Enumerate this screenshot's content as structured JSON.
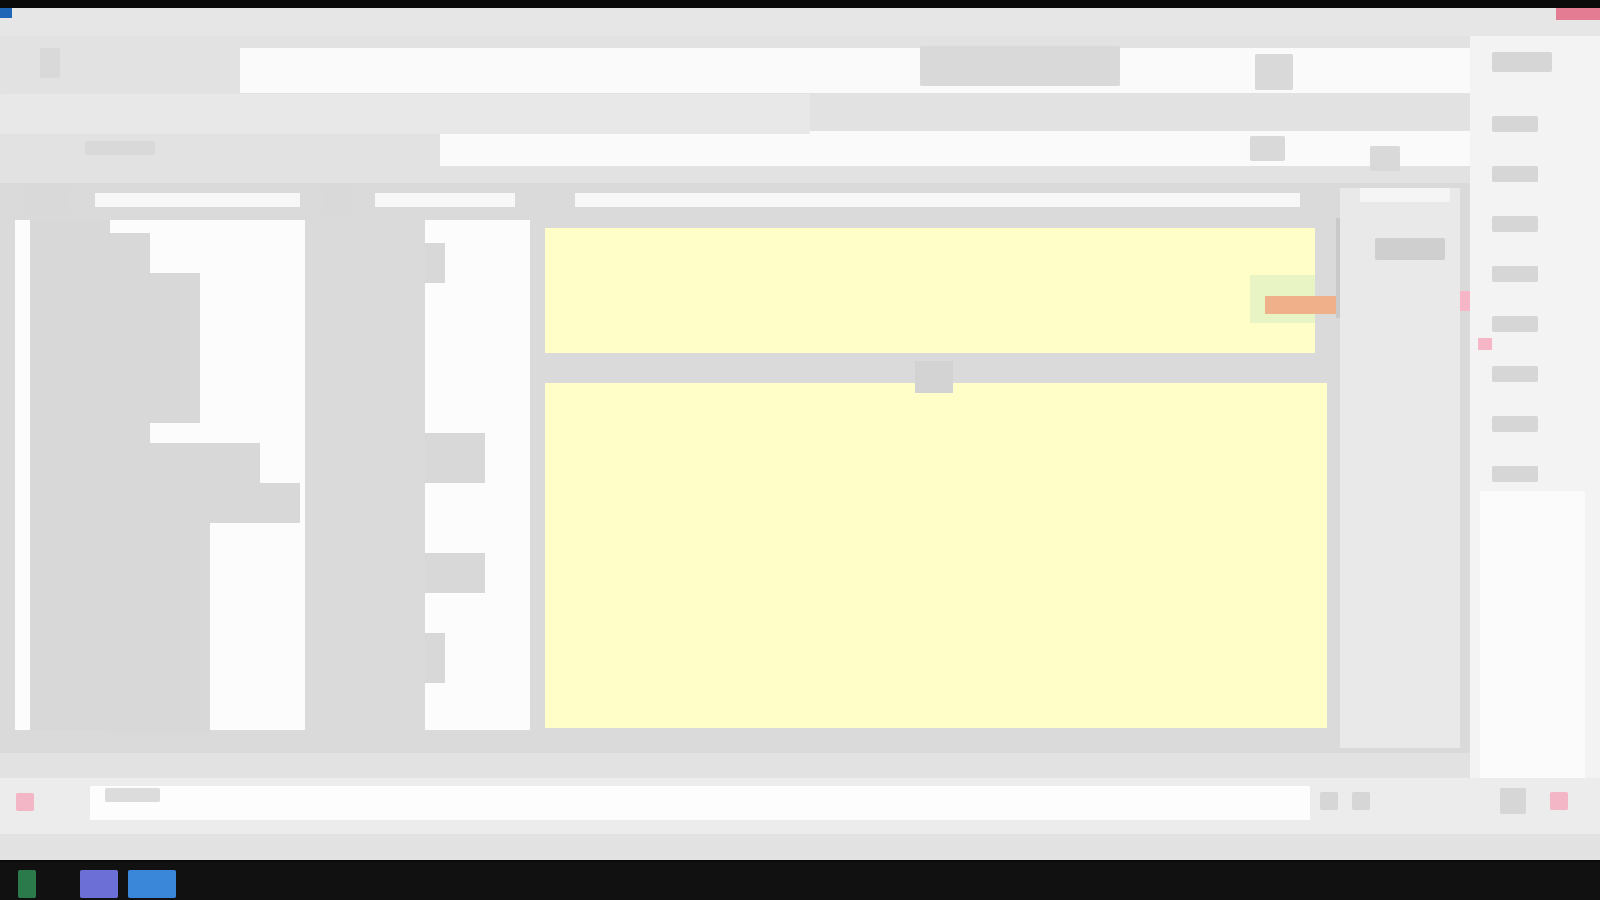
{
  "window": {
    "title": "",
    "accent": "#1f66b6",
    "close_color": "#e47c93"
  },
  "ribbon": {
    "groups": [
      {
        "label": ""
      },
      {
        "label": ""
      },
      {
        "label": ""
      }
    ]
  },
  "grid": {
    "column_headers": [
      "",
      "",
      "",
      ""
    ],
    "highlight_color": "#fffec8",
    "selection_color": "#f0b08a",
    "flag_color": "#f6b6c8",
    "sort_label": ""
  },
  "status": {
    "left_text": "",
    "right_text": ""
  },
  "taskbar": {
    "apps": [
      {
        "name": "app-1",
        "color": "#2b7a4b"
      },
      {
        "name": "app-2",
        "color": "#6b6fd6"
      },
      {
        "name": "app-3",
        "color": "#3a86d8"
      }
    ]
  }
}
